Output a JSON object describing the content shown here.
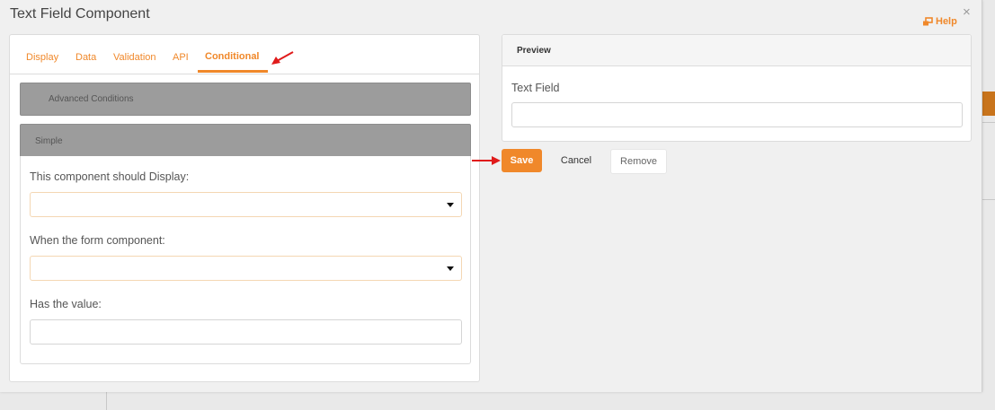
{
  "modal": {
    "title": "Text Field Component",
    "help_label": "Help",
    "close_glyph": "×"
  },
  "tabs": [
    {
      "label": "Display",
      "active": false
    },
    {
      "label": "Data",
      "active": false
    },
    {
      "label": "Validation",
      "active": false
    },
    {
      "label": "API",
      "active": false
    },
    {
      "label": "Conditional",
      "active": true
    }
  ],
  "sections": {
    "advanced": {
      "label": "Advanced Conditions"
    },
    "simple": {
      "label": "Simple"
    }
  },
  "fields": {
    "display": {
      "label": "This component should Display:",
      "value": ""
    },
    "when": {
      "label": "When the form component:",
      "value": ""
    },
    "has_value": {
      "label": "Has the value:",
      "value": ""
    }
  },
  "preview": {
    "header": "Preview",
    "field_label": "Text Field",
    "field_value": ""
  },
  "buttons": {
    "save": "Save",
    "cancel": "Cancel",
    "remove": "Remove"
  },
  "colors": {
    "accent": "#f0882a",
    "annotation_arrow": "#e01b1b",
    "collapse_header": "#9c9c9c"
  },
  "icons": {
    "help": "external-window-icon",
    "close": "close-icon",
    "select_caret": "caret-down-icon",
    "annotation": "red-arrow-icon"
  }
}
